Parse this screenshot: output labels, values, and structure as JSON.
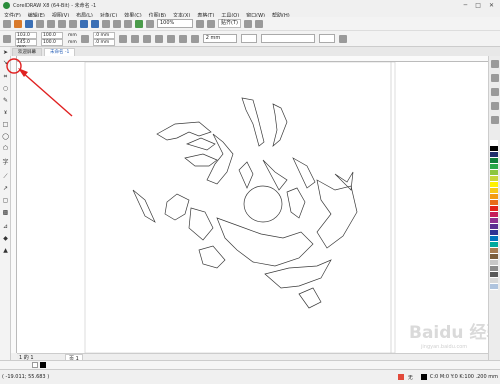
{
  "window": {
    "title": "CorelDRAW X8 (64-Bit) - 未命名 -1",
    "controls": [
      "─",
      "□",
      "✕"
    ]
  },
  "menu": {
    "items": [
      "文件(F)",
      "编辑(E)",
      "视图(V)",
      "布局(L)",
      "对象(C)",
      "效果(C)",
      "位图(B)",
      "文本(X)",
      "表格(T)",
      "工具(O)",
      "窗口(W)",
      "帮助(H)"
    ]
  },
  "toolbar": {
    "zoom_value": "100%",
    "snap_label": "贴齐(T)",
    "icons": [
      "new-icon",
      "open-icon",
      "save-icon",
      "print-icon",
      "cut-icon",
      "copy-icon",
      "paste-icon",
      "undo-icon",
      "redo-icon",
      "search-icon",
      "import-icon",
      "export-icon",
      "publish-icon",
      "app-launcher-icon",
      "zoom-icon",
      "full-screen-icon",
      "rulers-icon",
      "snap-icon",
      "options-icon",
      "launch-icon"
    ]
  },
  "propertybar": {
    "x": "103.0 mm",
    "y": "145.0 mm",
    "w": "100.0",
    "h": "100.0",
    "w_unit": "mm",
    "h_unit": "mm",
    "scale_x": ".0 mm",
    "scale_y": ".0 mm",
    "outline_width": "2 mm"
  },
  "tabs": {
    "items": [
      "欢迎屏幕",
      "未命名 -1"
    ]
  },
  "pagebar": {
    "page_label": "页 1",
    "page_count": "1 的 1"
  },
  "status": {
    "coords": "( -19.011; 55.683 )",
    "fill_text": "无",
    "outline_text": "C:0 M:0 Y:0 K:100  .200 mm"
  },
  "palette_colors": [
    "#ffffff",
    "#000000",
    "#1f2f6b",
    "#10803a",
    "#2aa84a",
    "#8cc63f",
    "#c8d63a",
    "#fff200",
    "#f7c916",
    "#f39c12",
    "#e86a1a",
    "#e2231a",
    "#c61c5a",
    "#8e2f8f",
    "#5b2e91",
    "#2e3192",
    "#0072bc",
    "#00a99d",
    "#a67c52",
    "#7d5f3c",
    "#c7c7c7",
    "#8a8a8a",
    "#5a5a5a",
    "#d8d8d8",
    "#b0c4de"
  ],
  "watermark": {
    "text": "Baidu 经验",
    "subtext": "jingyan.baidu.com"
  }
}
